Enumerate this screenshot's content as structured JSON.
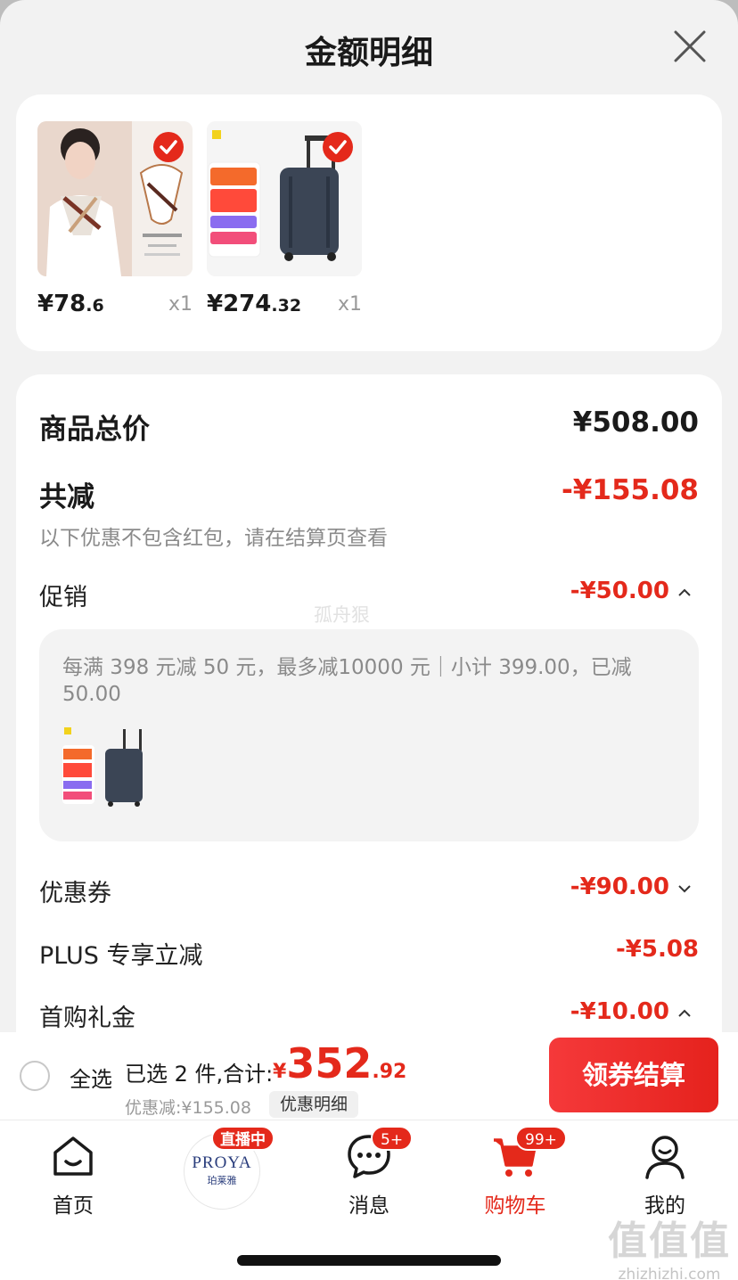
{
  "sheet": {
    "title": "金额明细"
  },
  "products": [
    {
      "price_int": "¥78",
      "price_dec": ".6",
      "qty": "x1"
    },
    {
      "price_int": "¥274",
      "price_dec": ".32",
      "qty": "x1"
    }
  ],
  "summary": {
    "total_label": "商品总价",
    "total_value": "¥508.00",
    "reduce_label": "共减",
    "reduce_value": "-¥155.08",
    "reduce_note": "以下优惠不包含红包，请在结算页查看",
    "promo_label": "促销",
    "promo_value": "-¥50.00",
    "promo_detail": "每满 398 元减 50 元，最多减10000 元｜小计 399.00，已减 50.00",
    "coupon_label": "优惠券",
    "coupon_value": "-¥90.00",
    "plus_label": "PLUS 专享立减",
    "plus_value": "-¥5.08",
    "firstbuy_label": "首购礼金",
    "firstbuy_value": "-¥10.00"
  },
  "watermark": "孤舟狠",
  "bottom_bar": {
    "select_all": "全选",
    "selected_text": "已选 2 件,合计:",
    "total_currency": "¥",
    "total_int": "352",
    "total_dec": ".92",
    "discount_text": "优惠减:¥155.08",
    "detail_tag": "优惠明细",
    "checkout": "领券结算"
  },
  "tabbar": {
    "home": "首页",
    "brand_name": "PROYA",
    "brand_sub": "珀莱雅",
    "live_badge": "直播中",
    "messages": "消息",
    "messages_badge": "5+",
    "cart": "购物车",
    "cart_badge": "99+",
    "mine": "我的"
  },
  "corner_watermark": {
    "big": "值值值",
    "small": "zhizhizhi.com"
  },
  "colors": {
    "accent_red": "#e4291b",
    "text": "#1a1a1a",
    "muted": "#999999"
  }
}
